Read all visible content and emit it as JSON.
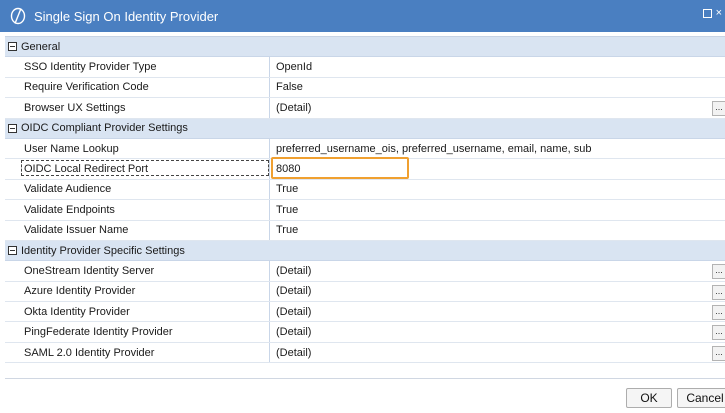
{
  "window": {
    "title": "Single Sign On Identity Provider"
  },
  "grid": {
    "sections": [
      {
        "label": "General",
        "rows": [
          {
            "name": "SSO Identity Provider Type",
            "value": "OpenId",
            "ellipsis": false
          },
          {
            "name": "Require Verification Code",
            "value": "False",
            "ellipsis": false
          },
          {
            "name": "Browser UX Settings",
            "value": "(Detail)",
            "ellipsis": true
          }
        ]
      },
      {
        "label": "OIDC Compliant Provider Settings",
        "rows": [
          {
            "name": "User Name Lookup",
            "value": "preferred_username_ois, preferred_username, email, name, sub",
            "ellipsis": false
          },
          {
            "name": "OIDC Local Redirect Port",
            "value": "8080",
            "ellipsis": false,
            "selected": true,
            "highlighted": true
          },
          {
            "name": "Validate Audience",
            "value": "True",
            "ellipsis": false
          },
          {
            "name": "Validate Endpoints",
            "value": "True",
            "ellipsis": false
          },
          {
            "name": "Validate Issuer Name",
            "value": "True",
            "ellipsis": false
          }
        ]
      },
      {
        "label": "Identity Provider Specific Settings",
        "rows": [
          {
            "name": "OneStream Identity Server",
            "value": "(Detail)",
            "ellipsis": true
          },
          {
            "name": "Azure Identity Provider",
            "value": "(Detail)",
            "ellipsis": true
          },
          {
            "name": "Okta Identity Provider",
            "value": "(Detail)",
            "ellipsis": true
          },
          {
            "name": "PingFederate Identity Provider",
            "value": "(Detail)",
            "ellipsis": true
          },
          {
            "name": "SAML 2.0 Identity Provider",
            "value": "(Detail)",
            "ellipsis": true
          }
        ]
      }
    ],
    "ellipsis_label": "..."
  },
  "buttons": {
    "ok_label": "OK",
    "cancel_label": "Cancel"
  },
  "colors": {
    "titlebar": "#4a7fc1",
    "category_row": "#d9e4f2",
    "highlight_border": "#f0a030"
  }
}
